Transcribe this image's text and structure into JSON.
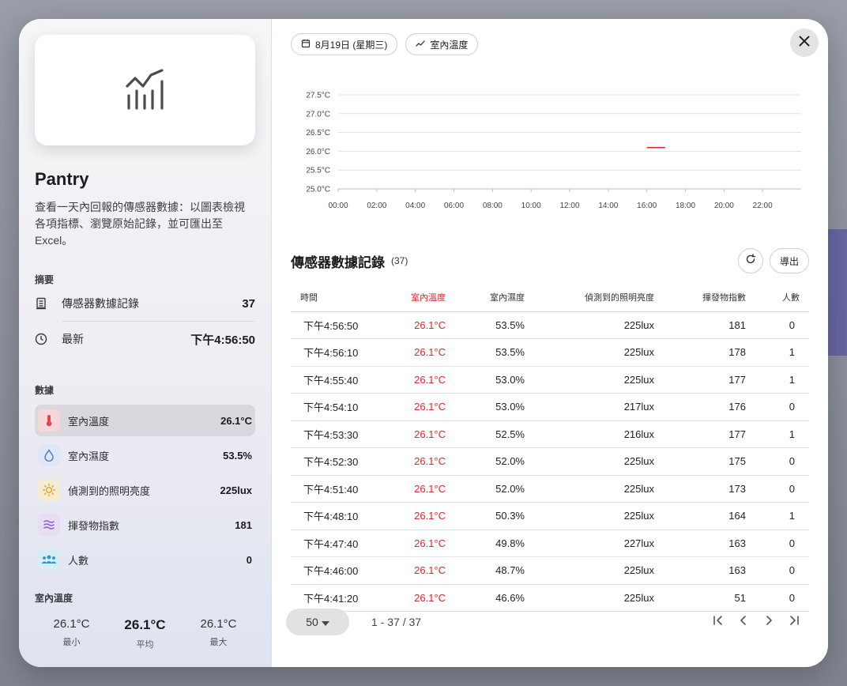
{
  "panel": {
    "title": "Pantry",
    "description": "查看一天內回報的傳感器數據：以圖表檢視各項指標、瀏覽原始記錄，並可匯出至 Excel。"
  },
  "summary": {
    "label": "摘要",
    "records_label": "傳感器數據記錄",
    "records_value": "37",
    "latest_label": "最新",
    "latest_value": "下午4:56:50"
  },
  "data_section": {
    "label": "數據",
    "metrics": [
      {
        "name": "室內溫度",
        "value": "26.1°C",
        "icon": "thermometer-icon",
        "bg": "#f6d6d8",
        "color": "#e0474f"
      },
      {
        "name": "室內濕度",
        "value": "53.5%",
        "icon": "droplet-icon",
        "bg": "#dfe6f6",
        "color": "#4a78d6"
      },
      {
        "name": "偵測到的照明亮度",
        "value": "225lux",
        "icon": "sun-icon",
        "bg": "#f5ecd4",
        "color": "#e0a92a"
      },
      {
        "name": "揮發物指數",
        "value": "181",
        "icon": "waves-icon",
        "bg": "#e7def3",
        "color": "#8a5cd0"
      },
      {
        "name": "人數",
        "value": "0",
        "icon": "people-icon",
        "bg": "#d7ecf5",
        "color": "#2b94c9"
      }
    ]
  },
  "stats": {
    "label": "室內溫度",
    "min_value": "26.1°C",
    "min_label": "最小",
    "avg_value": "26.1°C",
    "avg_label": "平均",
    "max_value": "26.1°C",
    "max_label": "最大"
  },
  "toolbar": {
    "date_chip": "8月19日 (星期三)",
    "metric_chip": "室內溫度"
  },
  "chart_data": {
    "type": "line",
    "y_ticks": [
      "25.0°C",
      "25.5°C",
      "26.0°C",
      "26.5°C",
      "27.0°C",
      "27.5°C"
    ],
    "ylim": [
      25.0,
      27.5
    ],
    "x_ticks": [
      "00:00",
      "02:00",
      "04:00",
      "06:00",
      "08:00",
      "10:00",
      "12:00",
      "14:00",
      "16:00",
      "18:00",
      "20:00",
      "22:00"
    ],
    "xlim": [
      0,
      24
    ],
    "x_unit": "hour",
    "series": [
      {
        "x": [
          16.0,
          16.95
        ],
        "y": [
          26.1,
          26.1
        ],
        "color": "#d9272e"
      }
    ],
    "grid": true
  },
  "records": {
    "title": "傳感器數據記錄",
    "count": "(37)",
    "export_label": "導出",
    "columns": [
      "時間",
      "室內溫度",
      "室內濕度",
      "偵測到的照明亮度",
      "揮發物指數",
      "人數"
    ],
    "rows": [
      [
        "下午4:56:50",
        "26.1°C",
        "53.5%",
        "225lux",
        "181",
        "0"
      ],
      [
        "下午4:56:10",
        "26.1°C",
        "53.5%",
        "225lux",
        "178",
        "1"
      ],
      [
        "下午4:55:40",
        "26.1°C",
        "53.0%",
        "225lux",
        "177",
        "1"
      ],
      [
        "下午4:54:10",
        "26.1°C",
        "53.0%",
        "217lux",
        "176",
        "0"
      ],
      [
        "下午4:53:30",
        "26.1°C",
        "52.5%",
        "216lux",
        "177",
        "1"
      ],
      [
        "下午4:52:30",
        "26.1°C",
        "52.0%",
        "225lux",
        "175",
        "0"
      ],
      [
        "下午4:51:40",
        "26.1°C",
        "52.0%",
        "225lux",
        "173",
        "0"
      ],
      [
        "下午4:48:10",
        "26.1°C",
        "50.3%",
        "225lux",
        "164",
        "1"
      ],
      [
        "下午4:47:40",
        "26.1°C",
        "49.8%",
        "227lux",
        "163",
        "0"
      ],
      [
        "下午4:46:00",
        "26.1°C",
        "48.7%",
        "225lux",
        "163",
        "0"
      ],
      [
        "下午4:41:20",
        "26.1°C",
        "46.6%",
        "225lux",
        "51",
        "0"
      ]
    ]
  },
  "pagination": {
    "rows_per_page": "50",
    "range": "1 - 37 / 37"
  }
}
